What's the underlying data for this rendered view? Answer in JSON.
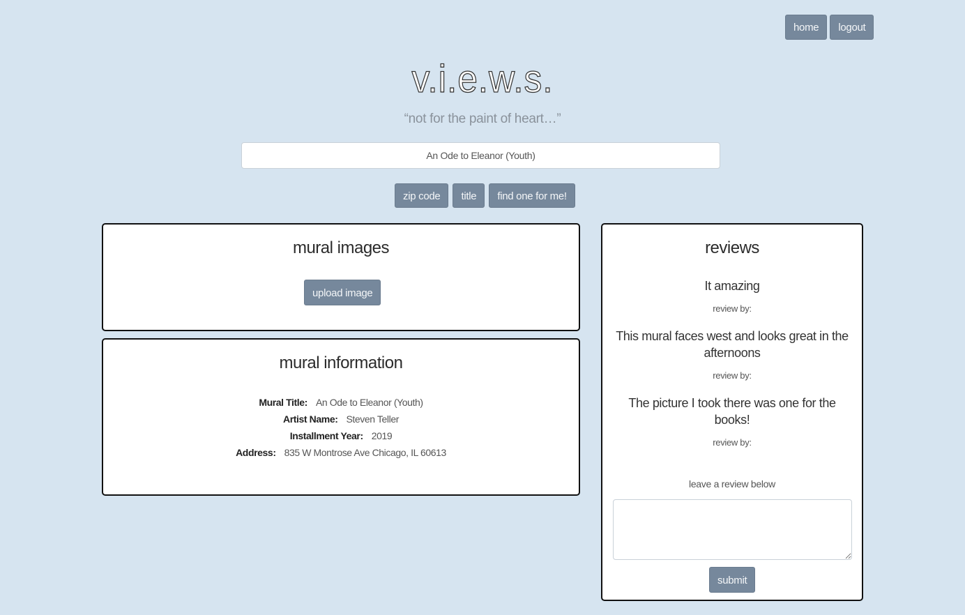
{
  "nav": {
    "home_label": "home",
    "logout_label": "logout"
  },
  "header": {
    "title": "v.i.e.w.s.",
    "tagline": "“not for the paint of heart…”"
  },
  "search": {
    "value": "An Ode to Eleanor (Youth)",
    "buttons": [
      "zip code",
      "title",
      "find one for me!"
    ]
  },
  "images_panel": {
    "title": "mural images",
    "upload_label": "upload image"
  },
  "info_panel": {
    "title": "mural information",
    "fields": [
      {
        "label": "Mural Title:",
        "value": "An Ode to Eleanor (Youth)"
      },
      {
        "label": "Artist Name:",
        "value": "Steven Teller"
      },
      {
        "label": "Installment Year:",
        "value": "2019"
      },
      {
        "label": "Address:",
        "value": "835 W Montrose Ave Chicago, IL 60613"
      }
    ]
  },
  "reviews_panel": {
    "title": "reviews",
    "reviews": [
      {
        "text": "It amazing",
        "by": "review by:"
      },
      {
        "text": "This mural faces west and looks great in the afternoons",
        "by": "review by:"
      },
      {
        "text": "The picture I took there was one for the books!",
        "by": "review by:"
      }
    ],
    "leave_label": "leave a review below",
    "input_value": "",
    "submit_label": "submit"
  },
  "colors": {
    "background": "#d6e4f0",
    "button": "#76889c",
    "panel_border": "#111111"
  }
}
